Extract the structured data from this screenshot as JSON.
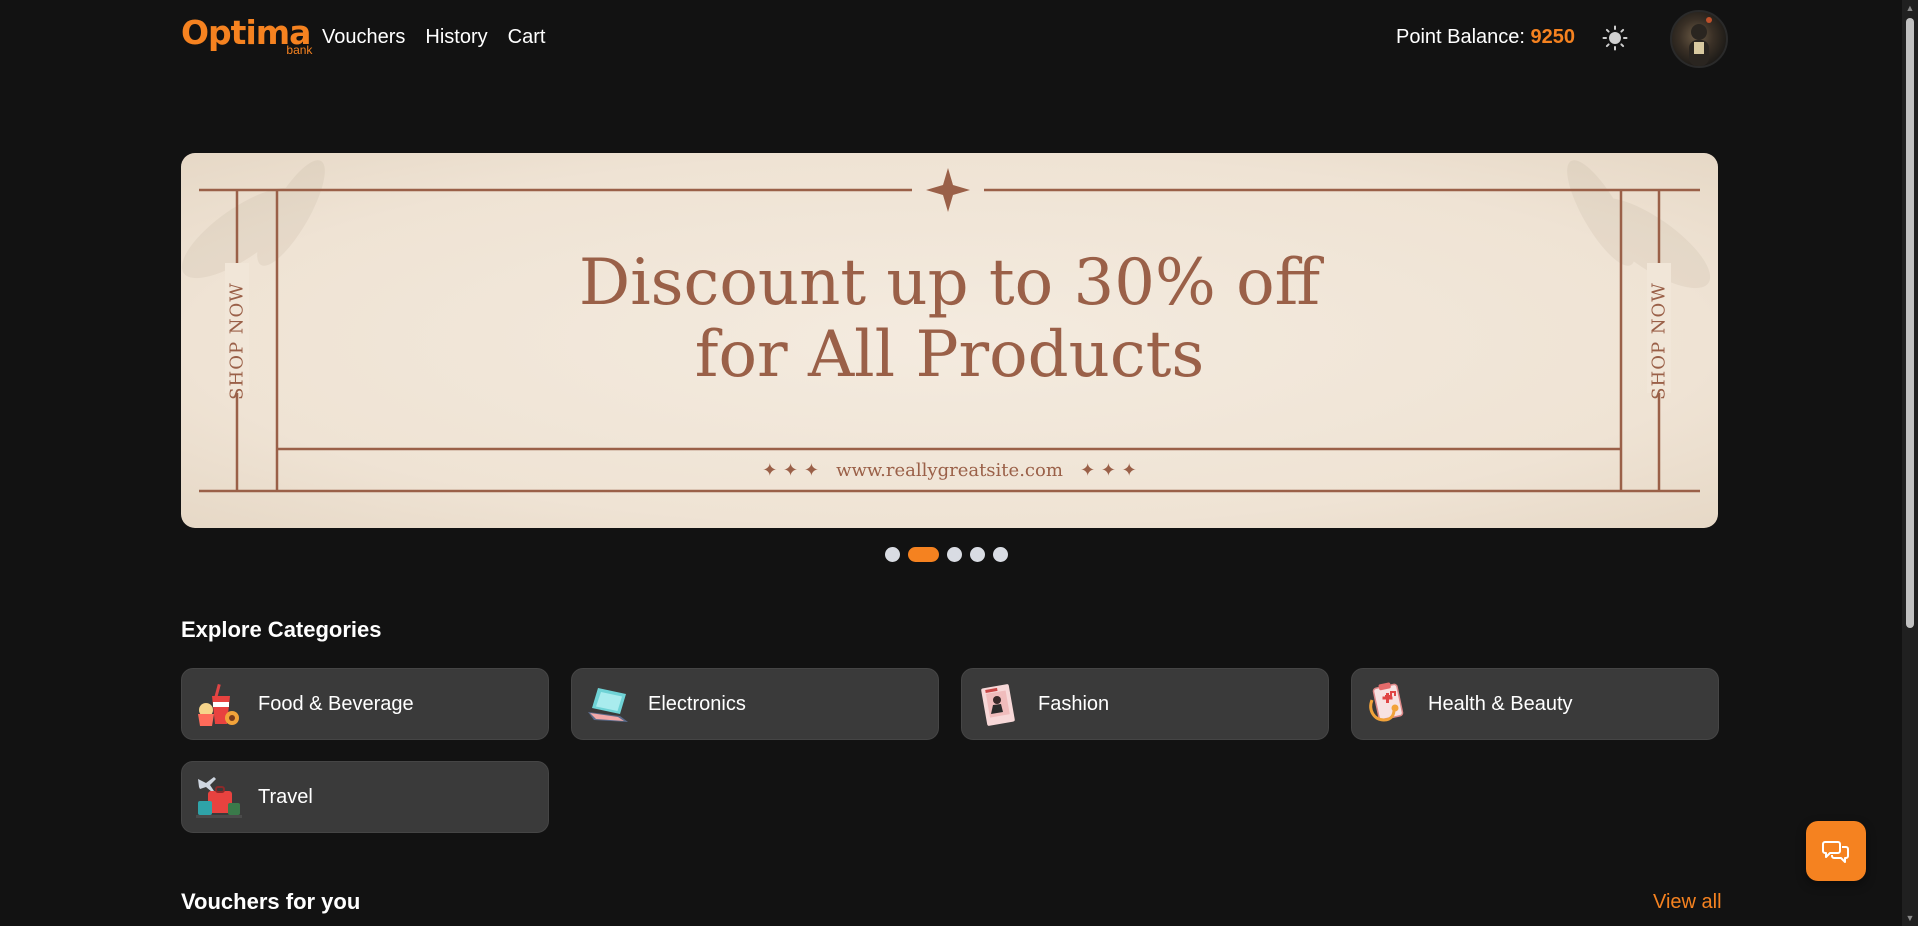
{
  "nav": {
    "logo_text": "Optima",
    "logo_sub": "bank",
    "links": [
      "Vouchers",
      "History",
      "Cart"
    ],
    "balance_label": "Point Balance:",
    "balance_value": "9250",
    "theme_icon": "sun-icon",
    "avatar_icon": "user-avatar"
  },
  "banner": {
    "headline_line1": "Discount up to 30% off",
    "headline_line2": "for All Products",
    "side_text": "SHOP NOW",
    "url_text": "✦ ✦ ✦   www.reallygreatsite.com   ✦ ✦ ✦",
    "background_color": "#efe3d4",
    "accent_color": "#9a6048"
  },
  "carousel": {
    "slide_count": 5,
    "active_index": 1
  },
  "categories": {
    "title": "Explore Categories",
    "items": [
      {
        "label": "Food & Beverage",
        "icon": "food-icon"
      },
      {
        "label": "Electronics",
        "icon": "laptop-icon"
      },
      {
        "label": "Fashion",
        "icon": "fashion-magazine-icon"
      },
      {
        "label": "Health & Beauty",
        "icon": "health-clipboard-icon"
      },
      {
        "label": "Travel",
        "icon": "travel-luggage-icon"
      }
    ]
  },
  "vouchers": {
    "title": "Vouchers for you",
    "view_all": "View all"
  },
  "chat": {
    "icon": "chat-bubbles-icon"
  },
  "colors": {
    "accent": "#f58220",
    "background": "#121212",
    "card": "#3a3a3a"
  }
}
